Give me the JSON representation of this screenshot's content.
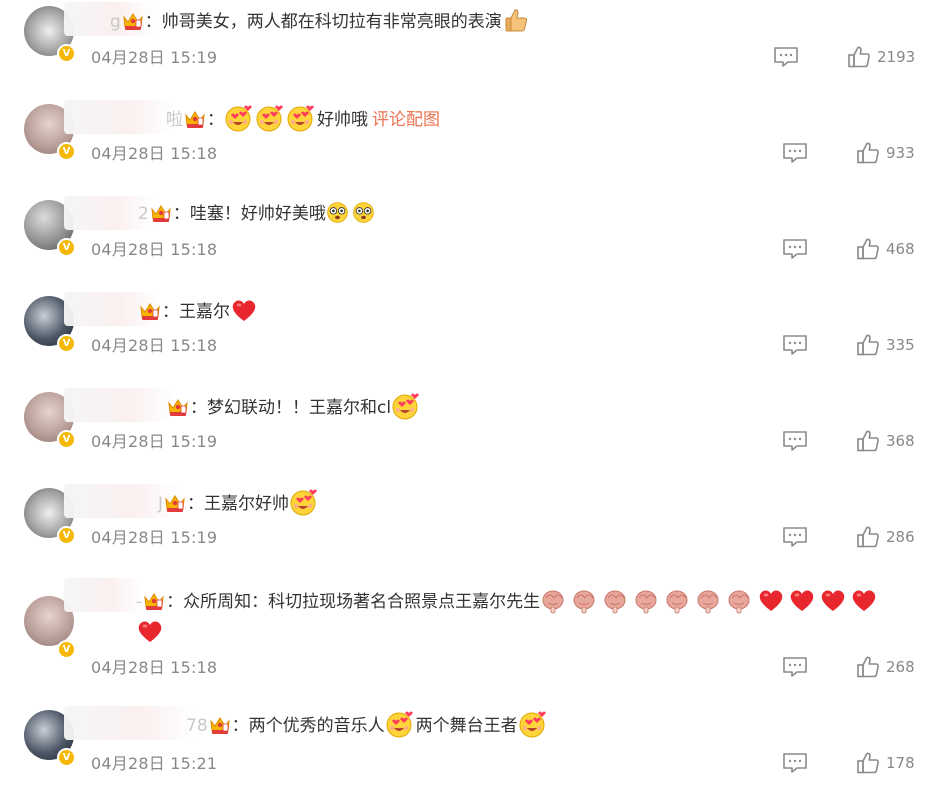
{
  "comments": [
    {
      "name_fragment": "g",
      "body": "：帅哥美女，两人都在科切拉有非常亮眼的表演",
      "emojis": [
        "thumbs-up"
      ],
      "time": "04月28日 15:19",
      "likes": "2193",
      "avatar_style": "gray3"
    },
    {
      "name_fragment": "啦",
      "body": "：",
      "emojis_before": [
        "heart-eyes-face",
        "heart-eyes-face",
        "heart-eyes-face"
      ],
      "tail_text": "好帅哦",
      "link_text": "评论配图",
      "time": "04月28日 15:18",
      "likes": "933",
      "avatar_style": "pink"
    },
    {
      "name_fragment": "2",
      "body": "：哇塞！好帅好美哦",
      "emojis": [
        "dizzy-face",
        "dizzy-face"
      ],
      "time": "04月28日 15:18",
      "likes": "468",
      "avatar_style": "gray2"
    },
    {
      "name_fragment": "",
      "body": "：王嘉尔",
      "emojis": [
        "red-heart"
      ],
      "time": "04月28日 15:18",
      "likes": "335",
      "avatar_style": "dark"
    },
    {
      "name_fragment": "",
      "body": "：梦幻联动！！王嘉尔和cl",
      "emojis": [
        "heart-eyes-face"
      ],
      "time": "04月28日 15:19",
      "likes": "368",
      "avatar_style": "pink"
    },
    {
      "name_fragment": "J",
      "body": "：王嘉尔好帅",
      "emojis": [
        "heart-eyes-face"
      ],
      "time": "04月28日 15:19",
      "likes": "286",
      "avatar_style": "gray3"
    },
    {
      "name_fragment": "-",
      "body": "：众所周知：科切拉现场著名合照景点王嘉尔先生",
      "emojis": [
        "roasted-chicken",
        "roasted-chicken",
        "roasted-chicken",
        "roasted-chicken",
        "roasted-chicken",
        "roasted-chicken",
        "roasted-chicken",
        "red-heart",
        "red-heart",
        "red-heart",
        "red-heart",
        "red-heart"
      ],
      "time": "04月28日 15:18",
      "likes": "268",
      "avatar_style": "pink"
    },
    {
      "name_fragment": "78",
      "body": "：两个优秀的音乐人",
      "mid_emoji": "heart-eyes-face",
      "tail_text": "两个舞台王者",
      "emojis": [
        "heart-eyes-face"
      ],
      "time": "04月28日 15:21",
      "likes": "178",
      "avatar_style": "dark"
    }
  ],
  "icons": {
    "reply": "comment-bubble-icon",
    "like": "thumbs-up-outline-icon",
    "member": "crown-member-icon",
    "verified": "verified-v-badge-icon"
  },
  "verified_letter": "V",
  "colors": {
    "meta_text": "#888888",
    "link": "#eb7350",
    "badge": "#f5b700",
    "icon": "#8a8a8a"
  }
}
